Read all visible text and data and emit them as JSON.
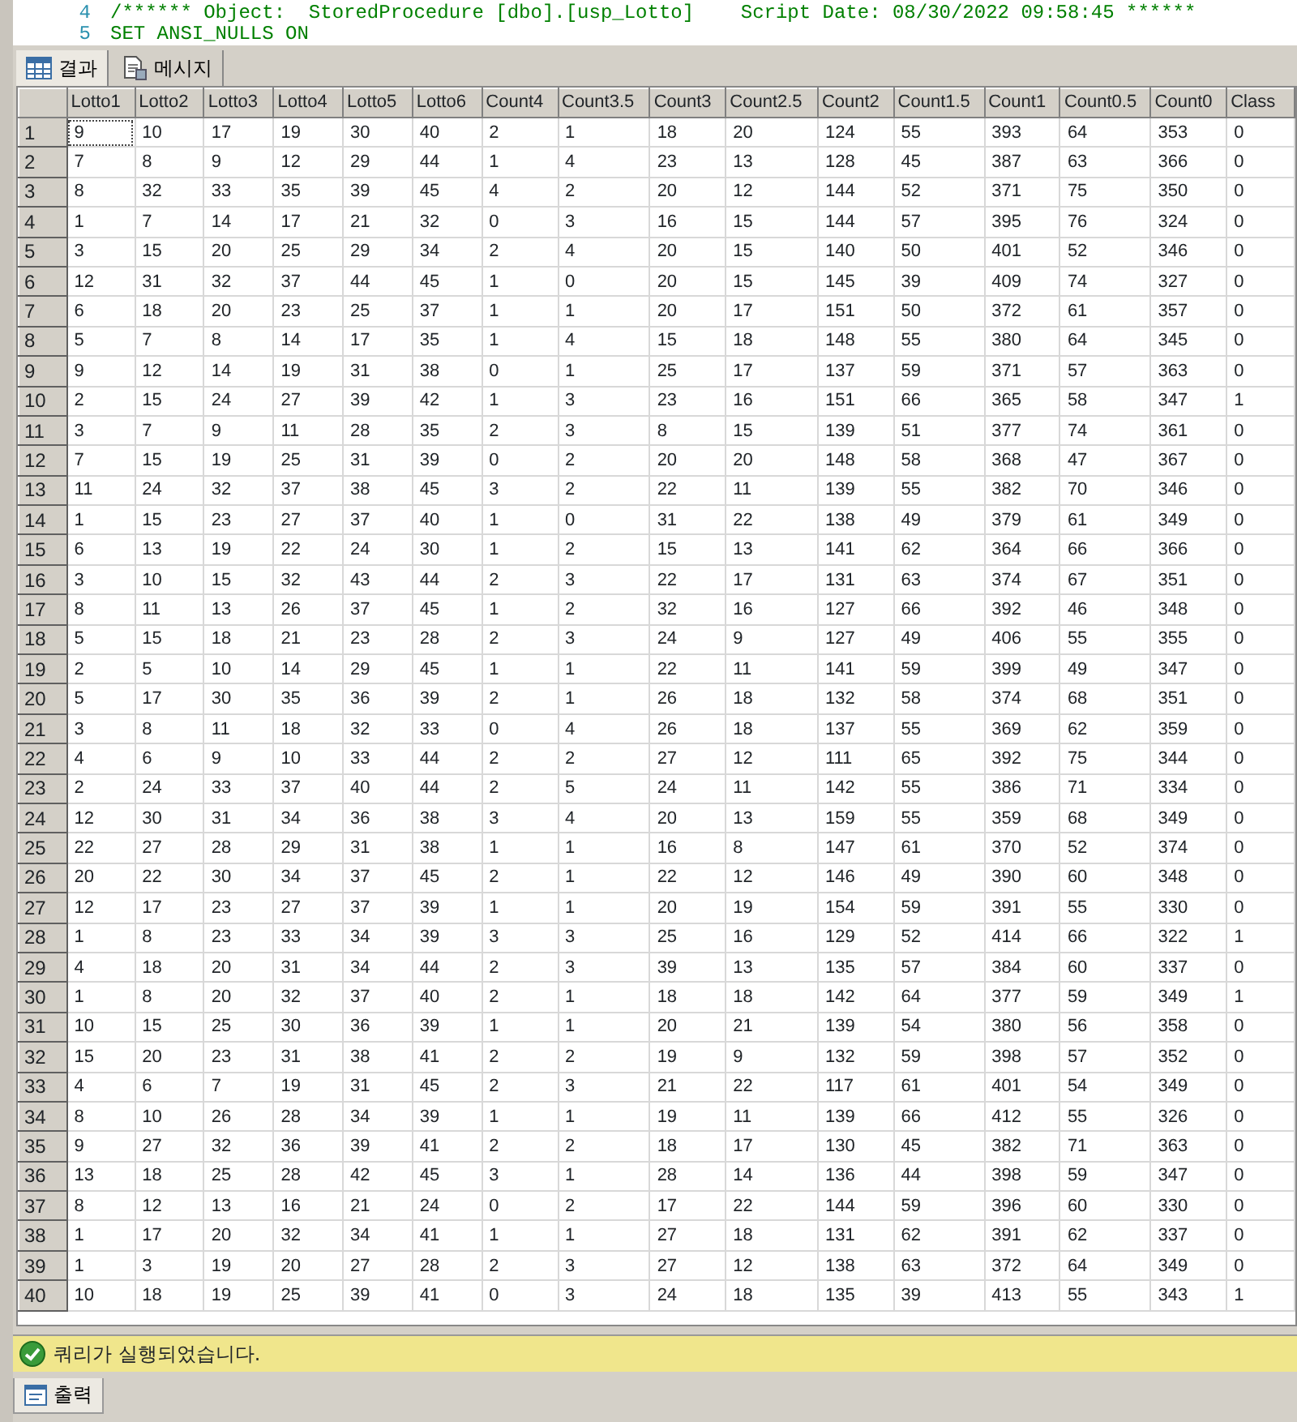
{
  "editor": {
    "lines": [
      {
        "number": "4",
        "text": "/****** Object:  StoredProcedure [dbo].[usp_Lotto]    Script Date: 08/30/2022 09:58:45 ******"
      },
      {
        "number": "5",
        "text": "SET ANSI_NULLS ON"
      }
    ]
  },
  "result_tabs": [
    {
      "label": "결과",
      "kind": "grid",
      "selected": true
    },
    {
      "label": "메시지",
      "kind": "messages",
      "selected": false
    }
  ],
  "table": {
    "columns": [
      "Lotto1",
      "Lotto2",
      "Lotto3",
      "Lotto4",
      "Lotto5",
      "Lotto6",
      "Count4",
      "Count3.5",
      "Count3",
      "Count2.5",
      "Count2",
      "Count1.5",
      "Count1",
      "Count0.5",
      "Count0",
      "Class"
    ],
    "rows": [
      {
        "number": "1",
        "selected": true,
        "cells": [
          "9",
          "10",
          "17",
          "19",
          "30",
          "40",
          "2",
          "1",
          "18",
          "20",
          "124",
          "55",
          "393",
          "64",
          "353",
          "0"
        ]
      },
      {
        "number": "2",
        "selected": false,
        "cells": [
          "7",
          "8",
          "9",
          "12",
          "29",
          "44",
          "1",
          "4",
          "23",
          "13",
          "128",
          "45",
          "387",
          "63",
          "366",
          "0"
        ]
      },
      {
        "number": "3",
        "selected": false,
        "cells": [
          "8",
          "32",
          "33",
          "35",
          "39",
          "45",
          "4",
          "2",
          "20",
          "12",
          "144",
          "52",
          "371",
          "75",
          "350",
          "0"
        ]
      },
      {
        "number": "4",
        "selected": false,
        "cells": [
          "1",
          "7",
          "14",
          "17",
          "21",
          "32",
          "0",
          "3",
          "16",
          "15",
          "144",
          "57",
          "395",
          "76",
          "324",
          "0"
        ]
      },
      {
        "number": "5",
        "selected": false,
        "cells": [
          "3",
          "15",
          "20",
          "25",
          "29",
          "34",
          "2",
          "4",
          "20",
          "15",
          "140",
          "50",
          "401",
          "52",
          "346",
          "0"
        ]
      },
      {
        "number": "6",
        "selected": false,
        "cells": [
          "12",
          "31",
          "32",
          "37",
          "44",
          "45",
          "1",
          "0",
          "20",
          "15",
          "145",
          "39",
          "409",
          "74",
          "327",
          "0"
        ]
      },
      {
        "number": "7",
        "selected": false,
        "cells": [
          "6",
          "18",
          "20",
          "23",
          "25",
          "37",
          "1",
          "1",
          "20",
          "17",
          "151",
          "50",
          "372",
          "61",
          "357",
          "0"
        ]
      },
      {
        "number": "8",
        "selected": false,
        "cells": [
          "5",
          "7",
          "8",
          "14",
          "17",
          "35",
          "1",
          "4",
          "15",
          "18",
          "148",
          "55",
          "380",
          "64",
          "345",
          "0"
        ]
      },
      {
        "number": "9",
        "selected": false,
        "cells": [
          "9",
          "12",
          "14",
          "19",
          "31",
          "38",
          "0",
          "1",
          "25",
          "17",
          "137",
          "59",
          "371",
          "57",
          "363",
          "0"
        ]
      },
      {
        "number": "10",
        "selected": false,
        "cells": [
          "2",
          "15",
          "24",
          "27",
          "39",
          "42",
          "1",
          "3",
          "23",
          "16",
          "151",
          "66",
          "365",
          "58",
          "347",
          "1"
        ]
      },
      {
        "number": "11",
        "selected": false,
        "cells": [
          "3",
          "7",
          "9",
          "11",
          "28",
          "35",
          "2",
          "3",
          "8",
          "15",
          "139",
          "51",
          "377",
          "74",
          "361",
          "0"
        ]
      },
      {
        "number": "12",
        "selected": false,
        "cells": [
          "7",
          "15",
          "19",
          "25",
          "31",
          "39",
          "0",
          "2",
          "20",
          "20",
          "148",
          "58",
          "368",
          "47",
          "367",
          "0"
        ]
      },
      {
        "number": "13",
        "selected": false,
        "cells": [
          "11",
          "24",
          "32",
          "37",
          "38",
          "45",
          "3",
          "2",
          "22",
          "11",
          "139",
          "55",
          "382",
          "70",
          "346",
          "0"
        ]
      },
      {
        "number": "14",
        "selected": false,
        "cells": [
          "1",
          "15",
          "23",
          "27",
          "37",
          "40",
          "1",
          "0",
          "31",
          "22",
          "138",
          "49",
          "379",
          "61",
          "349",
          "0"
        ]
      },
      {
        "number": "15",
        "selected": false,
        "cells": [
          "6",
          "13",
          "19",
          "22",
          "24",
          "30",
          "1",
          "2",
          "15",
          "13",
          "141",
          "62",
          "364",
          "66",
          "366",
          "0"
        ]
      },
      {
        "number": "16",
        "selected": false,
        "cells": [
          "3",
          "10",
          "15",
          "32",
          "43",
          "44",
          "2",
          "3",
          "22",
          "17",
          "131",
          "63",
          "374",
          "67",
          "351",
          "0"
        ]
      },
      {
        "number": "17",
        "selected": false,
        "cells": [
          "8",
          "11",
          "13",
          "26",
          "37",
          "45",
          "1",
          "2",
          "32",
          "16",
          "127",
          "66",
          "392",
          "46",
          "348",
          "0"
        ]
      },
      {
        "number": "18",
        "selected": false,
        "cells": [
          "5",
          "15",
          "18",
          "21",
          "23",
          "28",
          "2",
          "3",
          "24",
          "9",
          "127",
          "49",
          "406",
          "55",
          "355",
          "0"
        ]
      },
      {
        "number": "19",
        "selected": false,
        "cells": [
          "2",
          "5",
          "10",
          "14",
          "29",
          "45",
          "1",
          "1",
          "22",
          "11",
          "141",
          "59",
          "399",
          "49",
          "347",
          "0"
        ]
      },
      {
        "number": "20",
        "selected": false,
        "cells": [
          "5",
          "17",
          "30",
          "35",
          "36",
          "39",
          "2",
          "1",
          "26",
          "18",
          "132",
          "58",
          "374",
          "68",
          "351",
          "0"
        ]
      },
      {
        "number": "21",
        "selected": false,
        "cells": [
          "3",
          "8",
          "11",
          "18",
          "32",
          "33",
          "0",
          "4",
          "26",
          "18",
          "137",
          "55",
          "369",
          "62",
          "359",
          "0"
        ]
      },
      {
        "number": "22",
        "selected": false,
        "cells": [
          "4",
          "6",
          "9",
          "10",
          "33",
          "44",
          "2",
          "2",
          "27",
          "12",
          "111",
          "65",
          "392",
          "75",
          "344",
          "0"
        ]
      },
      {
        "number": "23",
        "selected": false,
        "cells": [
          "2",
          "24",
          "33",
          "37",
          "40",
          "44",
          "2",
          "5",
          "24",
          "11",
          "142",
          "55",
          "386",
          "71",
          "334",
          "0"
        ]
      },
      {
        "number": "24",
        "selected": false,
        "cells": [
          "12",
          "30",
          "31",
          "34",
          "36",
          "38",
          "3",
          "4",
          "20",
          "13",
          "159",
          "55",
          "359",
          "68",
          "349",
          "0"
        ]
      },
      {
        "number": "25",
        "selected": false,
        "cells": [
          "22",
          "27",
          "28",
          "29",
          "31",
          "38",
          "1",
          "1",
          "16",
          "8",
          "147",
          "61",
          "370",
          "52",
          "374",
          "0"
        ]
      },
      {
        "number": "26",
        "selected": false,
        "cells": [
          "20",
          "22",
          "30",
          "34",
          "37",
          "45",
          "2",
          "1",
          "22",
          "12",
          "146",
          "49",
          "390",
          "60",
          "348",
          "0"
        ]
      },
      {
        "number": "27",
        "selected": false,
        "cells": [
          "12",
          "17",
          "23",
          "27",
          "37",
          "39",
          "1",
          "1",
          "20",
          "19",
          "154",
          "59",
          "391",
          "55",
          "330",
          "0"
        ]
      },
      {
        "number": "28",
        "selected": false,
        "cells": [
          "1",
          "8",
          "23",
          "33",
          "34",
          "39",
          "3",
          "3",
          "25",
          "16",
          "129",
          "52",
          "414",
          "66",
          "322",
          "1"
        ]
      },
      {
        "number": "29",
        "selected": false,
        "cells": [
          "4",
          "18",
          "20",
          "31",
          "34",
          "44",
          "2",
          "3",
          "39",
          "13",
          "135",
          "57",
          "384",
          "60",
          "337",
          "0"
        ]
      },
      {
        "number": "30",
        "selected": false,
        "cells": [
          "1",
          "8",
          "20",
          "32",
          "37",
          "40",
          "2",
          "1",
          "18",
          "18",
          "142",
          "64",
          "377",
          "59",
          "349",
          "1"
        ]
      },
      {
        "number": "31",
        "selected": false,
        "cells": [
          "10",
          "15",
          "25",
          "30",
          "36",
          "39",
          "1",
          "1",
          "20",
          "21",
          "139",
          "54",
          "380",
          "56",
          "358",
          "0"
        ]
      },
      {
        "number": "32",
        "selected": false,
        "cells": [
          "15",
          "20",
          "23",
          "31",
          "38",
          "41",
          "2",
          "2",
          "19",
          "9",
          "132",
          "59",
          "398",
          "57",
          "352",
          "0"
        ]
      },
      {
        "number": "33",
        "selected": false,
        "cells": [
          "4",
          "6",
          "7",
          "19",
          "31",
          "45",
          "2",
          "3",
          "21",
          "22",
          "117",
          "61",
          "401",
          "54",
          "349",
          "0"
        ]
      },
      {
        "number": "34",
        "selected": false,
        "cells": [
          "8",
          "10",
          "26",
          "28",
          "34",
          "39",
          "1",
          "1",
          "19",
          "11",
          "139",
          "66",
          "412",
          "55",
          "326",
          "0"
        ]
      },
      {
        "number": "35",
        "selected": false,
        "cells": [
          "9",
          "27",
          "32",
          "36",
          "39",
          "41",
          "2",
          "2",
          "18",
          "17",
          "130",
          "45",
          "382",
          "71",
          "363",
          "0"
        ]
      },
      {
        "number": "36",
        "selected": false,
        "cells": [
          "13",
          "18",
          "25",
          "28",
          "42",
          "45",
          "3",
          "1",
          "28",
          "14",
          "136",
          "44",
          "398",
          "59",
          "347",
          "0"
        ]
      },
      {
        "number": "37",
        "selected": false,
        "cells": [
          "8",
          "12",
          "13",
          "16",
          "21",
          "24",
          "0",
          "2",
          "17",
          "22",
          "144",
          "59",
          "396",
          "60",
          "330",
          "0"
        ]
      },
      {
        "number": "38",
        "selected": false,
        "cells": [
          "1",
          "17",
          "20",
          "32",
          "34",
          "41",
          "1",
          "1",
          "27",
          "18",
          "131",
          "62",
          "391",
          "62",
          "337",
          "0"
        ]
      },
      {
        "number": "39",
        "selected": false,
        "cells": [
          "1",
          "3",
          "19",
          "20",
          "27",
          "28",
          "2",
          "3",
          "27",
          "12",
          "138",
          "63",
          "372",
          "64",
          "349",
          "0"
        ]
      },
      {
        "number": "40",
        "selected": false,
        "cells": [
          "10",
          "18",
          "19",
          "25",
          "39",
          "41",
          "0",
          "3",
          "24",
          "18",
          "135",
          "39",
          "413",
          "55",
          "343",
          "1"
        ]
      }
    ]
  },
  "status_bar": {
    "kind": "success",
    "text": "쿼리가 실행되었습니다."
  },
  "bottom_tabs": [
    {
      "label": "출력",
      "selected": true
    }
  ]
}
